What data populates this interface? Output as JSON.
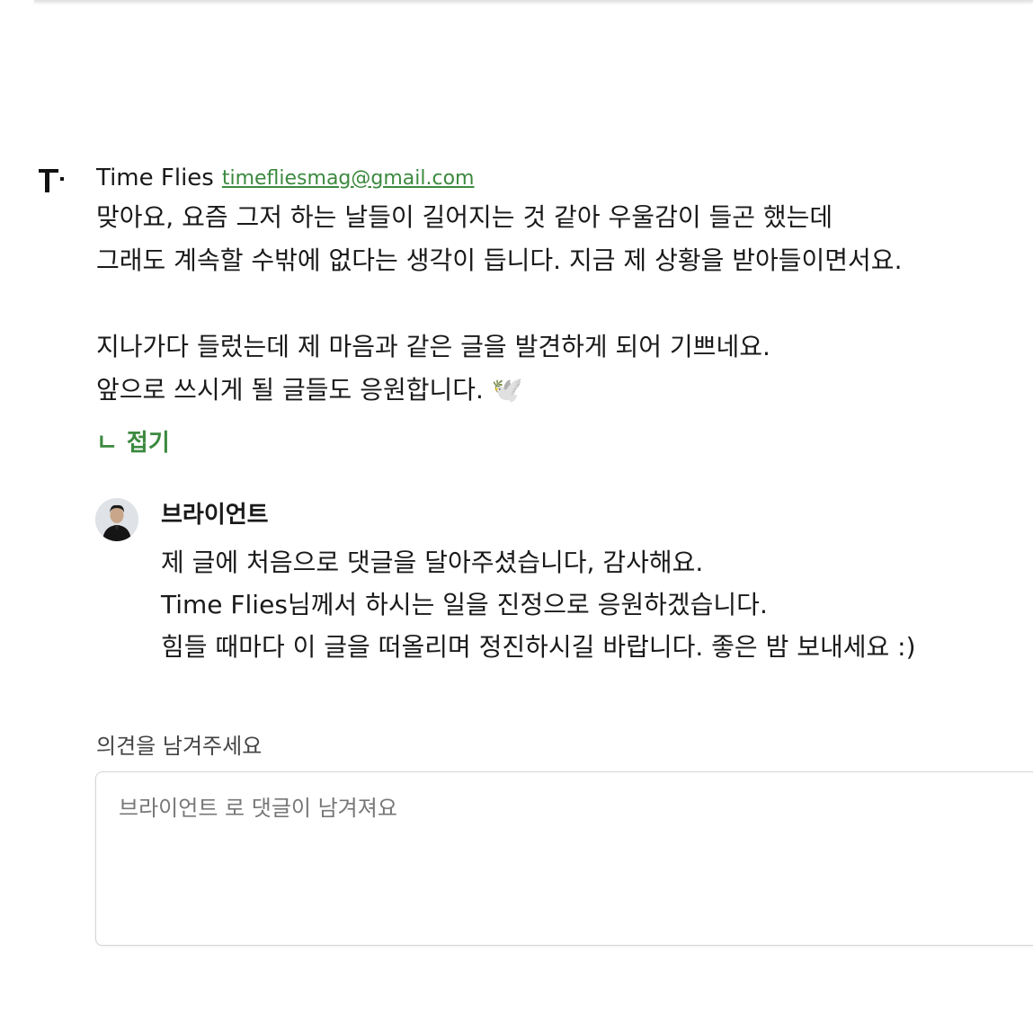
{
  "comment": {
    "author_name": "Time Flies",
    "author_email": "timefliesmag@gmail.com",
    "text": "맞아요, 요즘 그저 하는 날들이 길어지는 것 같아 우울감이 들곤 했는데\n그래도 계속할 수밖에 없다는 생각이 듭니다. 지금 제 상황을 받아들이면서요.\n\n지나가다 들렀는데 제 마음과 같은 글을 발견하게 되어 기쁘네요.\n앞으로 쓰시게 될 글들도 응원합니다. 🕊️",
    "fold_icon": "ㄴ",
    "fold_label": "접기"
  },
  "reply": {
    "author_name": "브라이언트",
    "text": "제 글에 처음으로 댓글을 달아주셨습니다, 감사해요.\nTime Flies님께서 하시는 일을 진정으로 응원하겠습니다.\n힘들 때마다 이 글을 떠올리며 정진하시길 바랍니다. 좋은 밤 보내세요 :)"
  },
  "form": {
    "label": "의견을 남겨주세요",
    "placeholder": "브라이언트 로 댓글이 남겨져요"
  },
  "colors": {
    "accent_green": "#3c8a3f",
    "text": "#1a1a1a"
  },
  "icons": {
    "site_logo": "time-flies-logo-icon",
    "avatar": "user-avatar-photo"
  }
}
